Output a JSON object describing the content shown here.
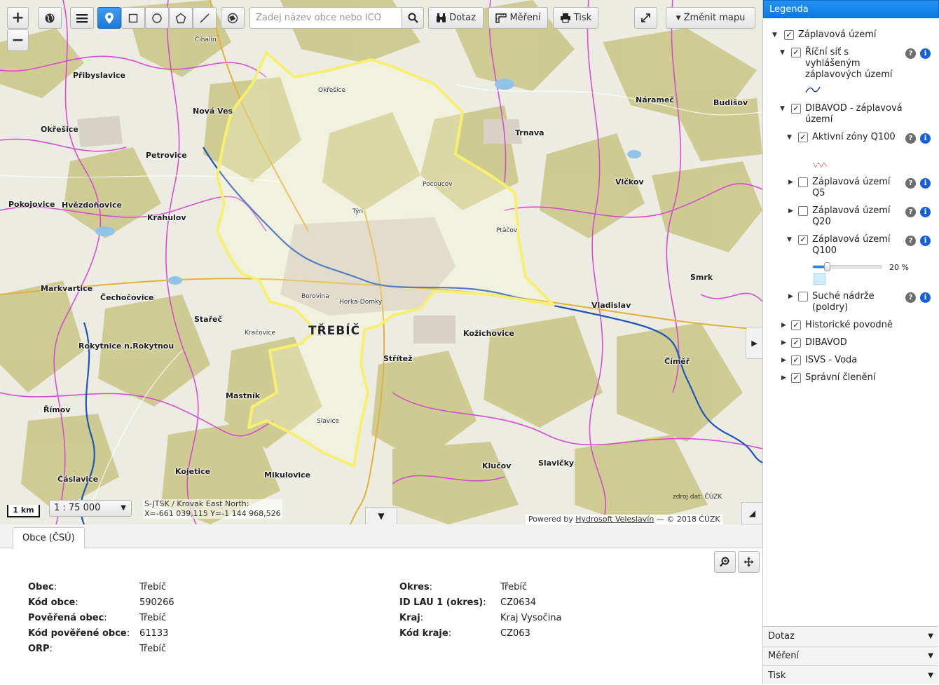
{
  "toolbar": {
    "search_placeholder": "Zadej název obce nebo IČO",
    "query_label": "Dotaz",
    "measure_label": "Měření",
    "print_label": "Tisk",
    "change_map_label": "Změnit mapu",
    "zoom_in": "+",
    "zoom_out": "−"
  },
  "map": {
    "scale_bar": "1 km",
    "scale_value": "1 : 75 000",
    "coords_line1": "S-JTSK / Krovak East North:",
    "coords_line2": "X=-661 039,115 Y=-1 144 968,526",
    "source": "zdroj dat: ČÚZK",
    "attribution_prefix": "Powered by",
    "attribution_link": "Hydrosoft Veleslavín",
    "attribution_suffix": "— © 2018 ČÚZK",
    "places": [
      {
        "name": "TŘEBÍČ",
        "cls": "big"
      },
      {
        "name": "Přibyslavice"
      },
      {
        "name": "Nová Ves"
      },
      {
        "name": "Okřešice"
      },
      {
        "name": "Okřešice"
      },
      {
        "name": "Petrovice"
      },
      {
        "name": "Pokojovice"
      },
      {
        "name": "Hvězdoňovice"
      },
      {
        "name": "Krahulov"
      },
      {
        "name": "Markvartice"
      },
      {
        "name": "Čechočovice"
      },
      {
        "name": "Stařeč"
      },
      {
        "name": "Rokytnice n.Rokytnou"
      },
      {
        "name": "Mastník"
      },
      {
        "name": "Mikulovice"
      },
      {
        "name": "Kojetice"
      },
      {
        "name": "Čáslavice"
      },
      {
        "name": "Římov"
      },
      {
        "name": "Střítež"
      },
      {
        "name": "Kožichovice"
      },
      {
        "name": "Trnava"
      },
      {
        "name": "Náramеč"
      },
      {
        "name": "Budišov"
      },
      {
        "name": "Smrk"
      },
      {
        "name": "Vladislav"
      },
      {
        "name": "Číměř"
      },
      {
        "name": "Slavičky"
      },
      {
        "name": "Kračovice"
      },
      {
        "name": "Klučov"
      },
      {
        "name": "Ptáčov"
      },
      {
        "name": "Pocoucov"
      },
      {
        "name": "Horka-Domky"
      },
      {
        "name": "Borovina"
      },
      {
        "name": "Vlčkov"
      },
      {
        "name": "Čihalín"
      },
      {
        "name": "Týn"
      },
      {
        "name": "Slavice"
      }
    ]
  },
  "bottom": {
    "tab_label": "Obce (ČSÚ)",
    "left": [
      {
        "k": "Obec",
        "v": "Třebíč"
      },
      {
        "k": "Kód obce",
        "v": "590266"
      },
      {
        "k": "Pověřená obec",
        "v": "Třebíč"
      },
      {
        "k": "Kód pověřené obce",
        "v": "61133"
      },
      {
        "k": "ORP",
        "v": "Třebíč"
      }
    ],
    "right": [
      {
        "k": "Okres",
        "v": "Třebíč"
      },
      {
        "k": "ID LAU 1 (okres)",
        "v": "CZ0634"
      },
      {
        "k": "Kraj",
        "v": "Kraj Vysočina"
      },
      {
        "k": "Kód kraje",
        "v": "CZ063"
      }
    ]
  },
  "legend": {
    "title": "Legenda",
    "root": "Záplavová území",
    "river_net": "Říční síť s vyhlášeným záplavových území",
    "dibavod_group": "DIBAVOD - záplavová území",
    "active_zones": "Aktivní zóny Q100",
    "q5": "Záplavová území Q5",
    "q20": "Záplavová území Q20",
    "q100": "Záplavová území Q100",
    "opacity": "20 %",
    "opacity_fraction": 0.2,
    "dry_dams": "Suché nádrže (poldry)",
    "historic": "Historické povodně",
    "dibavod": "DIBAVOD",
    "isvs": "ISVS - Voda",
    "admin": "Správní členění"
  },
  "accordion": {
    "query": "Dotaz",
    "measure": "Měření",
    "print": "Tisk"
  },
  "colors": {
    "accent": "#0b79de",
    "boundary_highlight": "#f7ef70",
    "district_lines": "#d63ed1",
    "forest": "#c9c98a",
    "river": "#1b56b8"
  }
}
